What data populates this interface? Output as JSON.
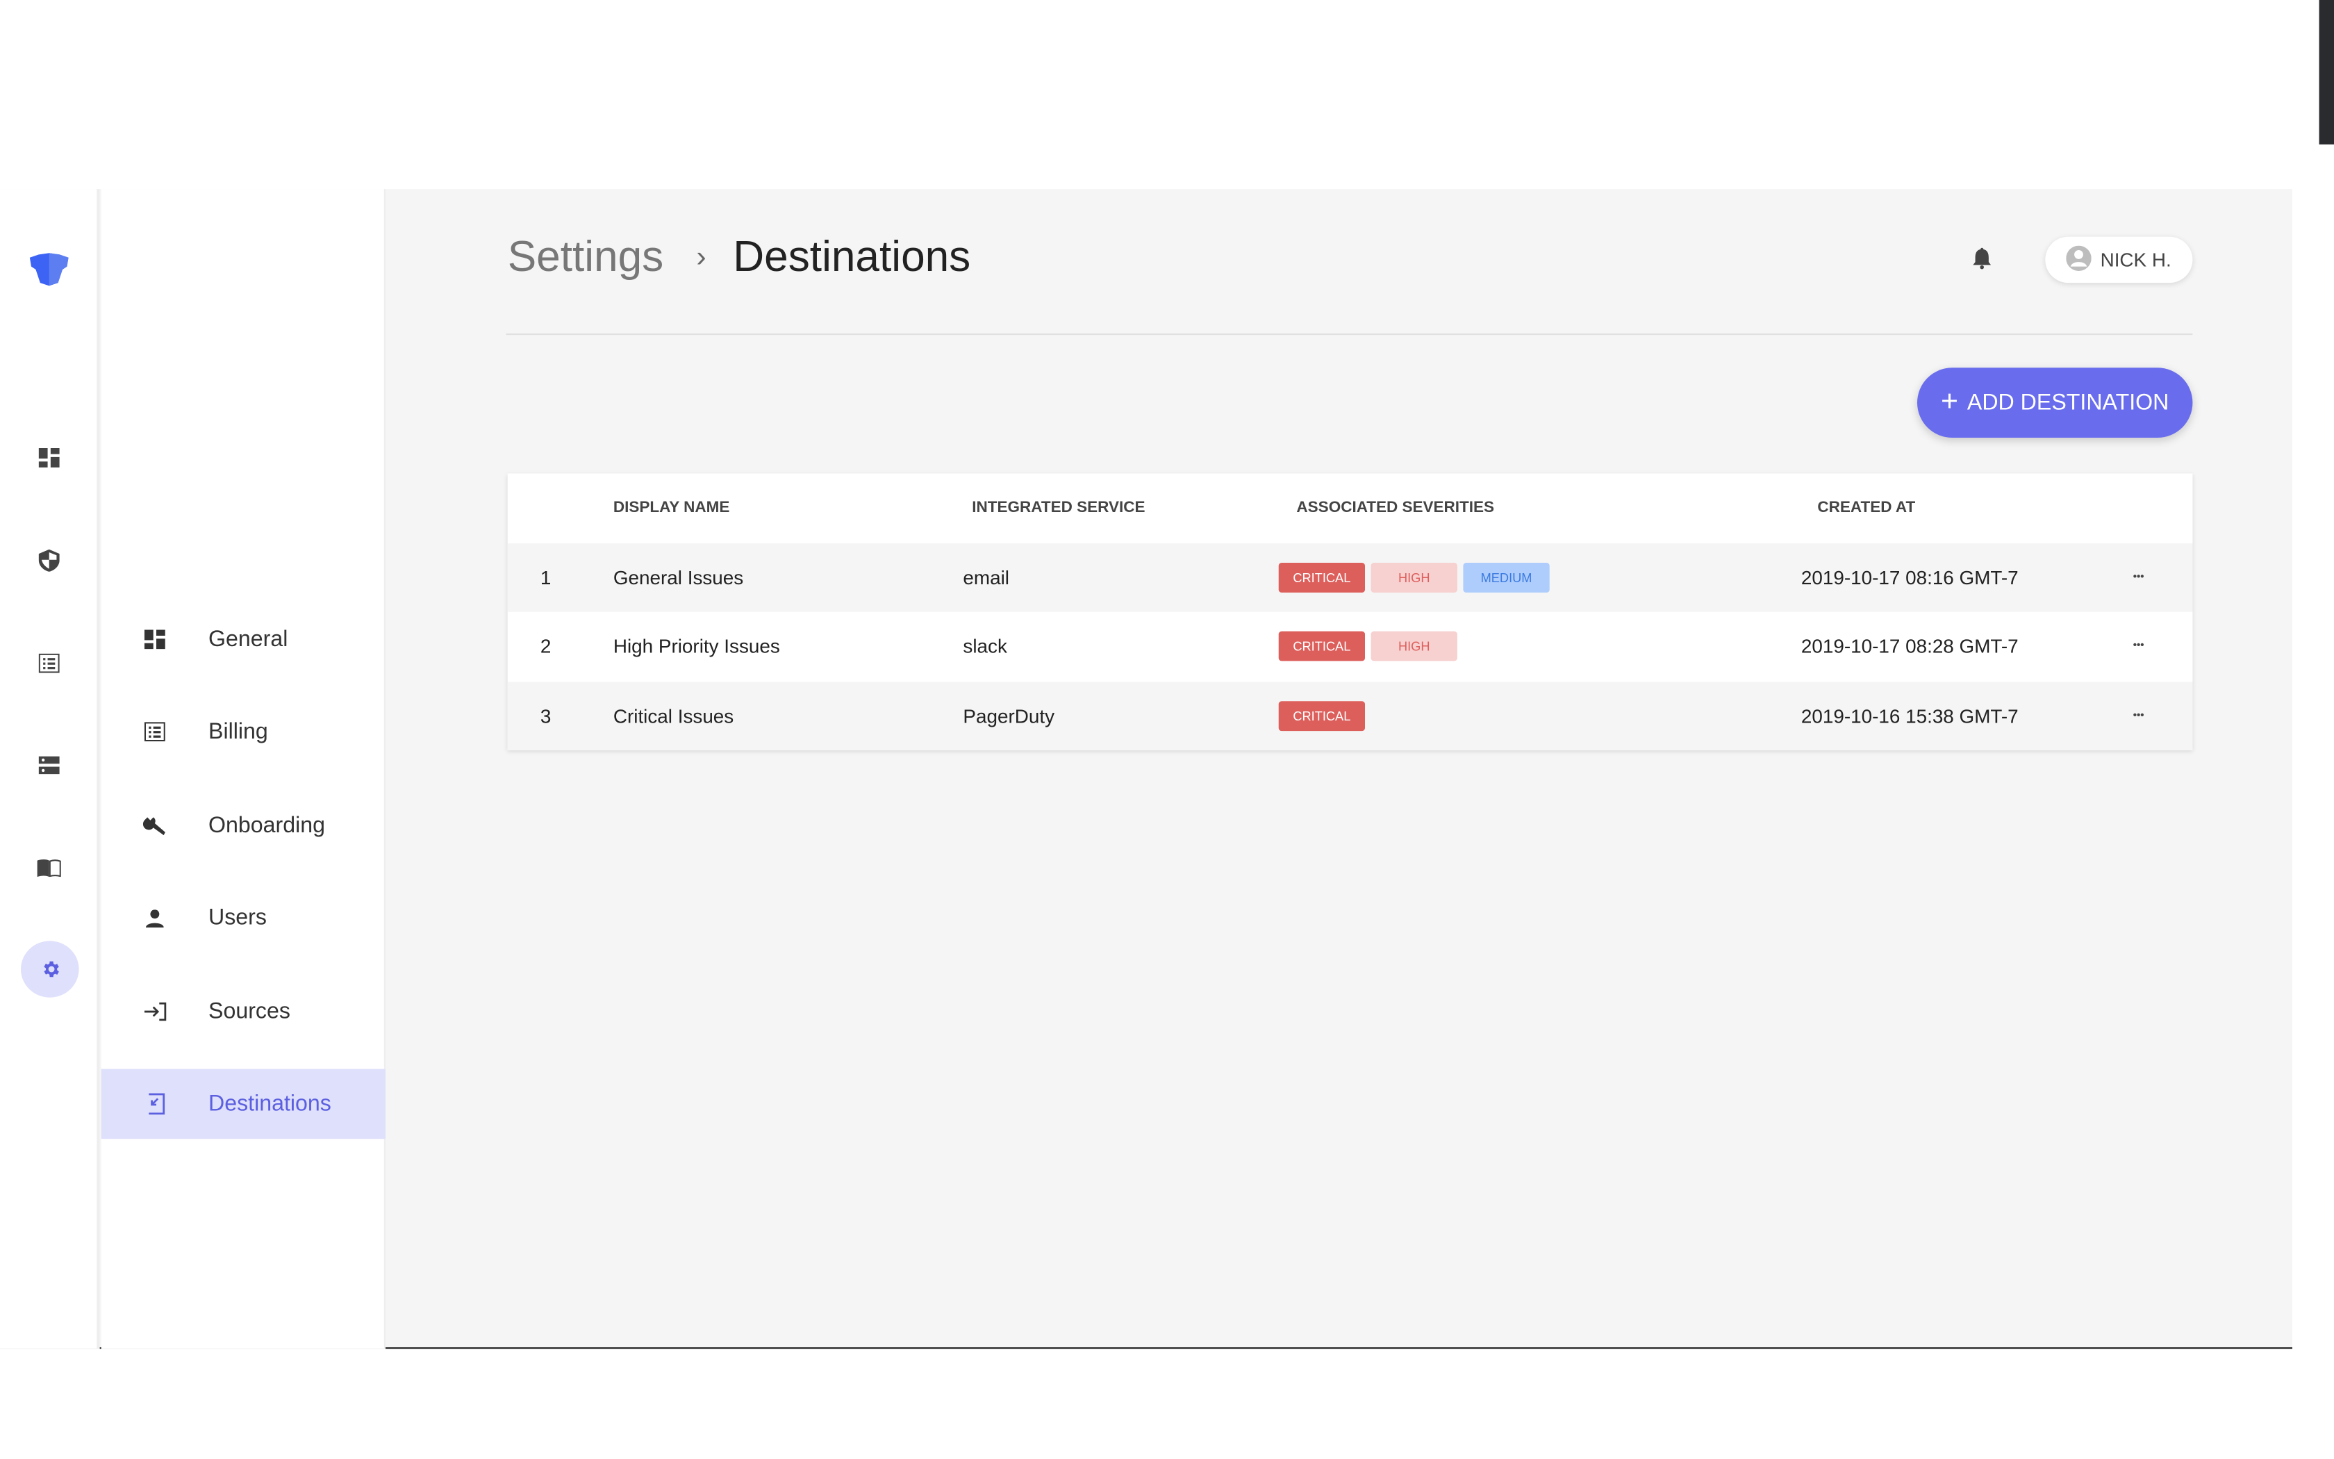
{
  "colors": {
    "accent": "#696ded",
    "critical": "#dd5f5c",
    "high_bg": "#f7d0d0",
    "medium_bg": "#aecdfc",
    "background": "#f5f5f5"
  },
  "rail": {
    "icons": [
      "logo-icon",
      "dashboard-icon",
      "shield-icon",
      "list-icon",
      "storage-icon",
      "book-icon",
      "gear-icon"
    ],
    "active": "gear-icon"
  },
  "submenu": {
    "items": [
      {
        "label": "General",
        "icon": "dashboard-icon"
      },
      {
        "label": "Billing",
        "icon": "list-icon"
      },
      {
        "label": "Onboarding",
        "icon": "wrench-icon"
      },
      {
        "label": "Users",
        "icon": "person-icon"
      },
      {
        "label": "Sources",
        "icon": "login-icon"
      },
      {
        "label": "Destinations",
        "icon": "logout-icon",
        "active": true
      }
    ]
  },
  "header": {
    "breadcrumb_parent": "Settings",
    "breadcrumb_separator": "›",
    "title": "Destinations",
    "user_name": "NICK H."
  },
  "toolbar": {
    "add_label": "ADD DESTINATION"
  },
  "table": {
    "columns": [
      "",
      "DISPLAY NAME",
      "INTEGRATED SERVICE",
      "ASSOCIATED SEVERITIES",
      "CREATED AT",
      ""
    ],
    "rows": [
      {
        "index": "1",
        "name": "General Issues",
        "service": "email",
        "severities": [
          "CRITICAL",
          "HIGH",
          "MEDIUM"
        ],
        "created": "2019-10-17 08:16 GMT-7"
      },
      {
        "index": "2",
        "name": "High Priority Issues",
        "service": "slack",
        "severities": [
          "CRITICAL",
          "HIGH"
        ],
        "created": "2019-10-17 08:28 GMT-7"
      },
      {
        "index": "3",
        "name": "Critical Issues",
        "service": "PagerDuty",
        "severities": [
          "CRITICAL"
        ],
        "created": "2019-10-16 15:38 GMT-7"
      }
    ]
  }
}
